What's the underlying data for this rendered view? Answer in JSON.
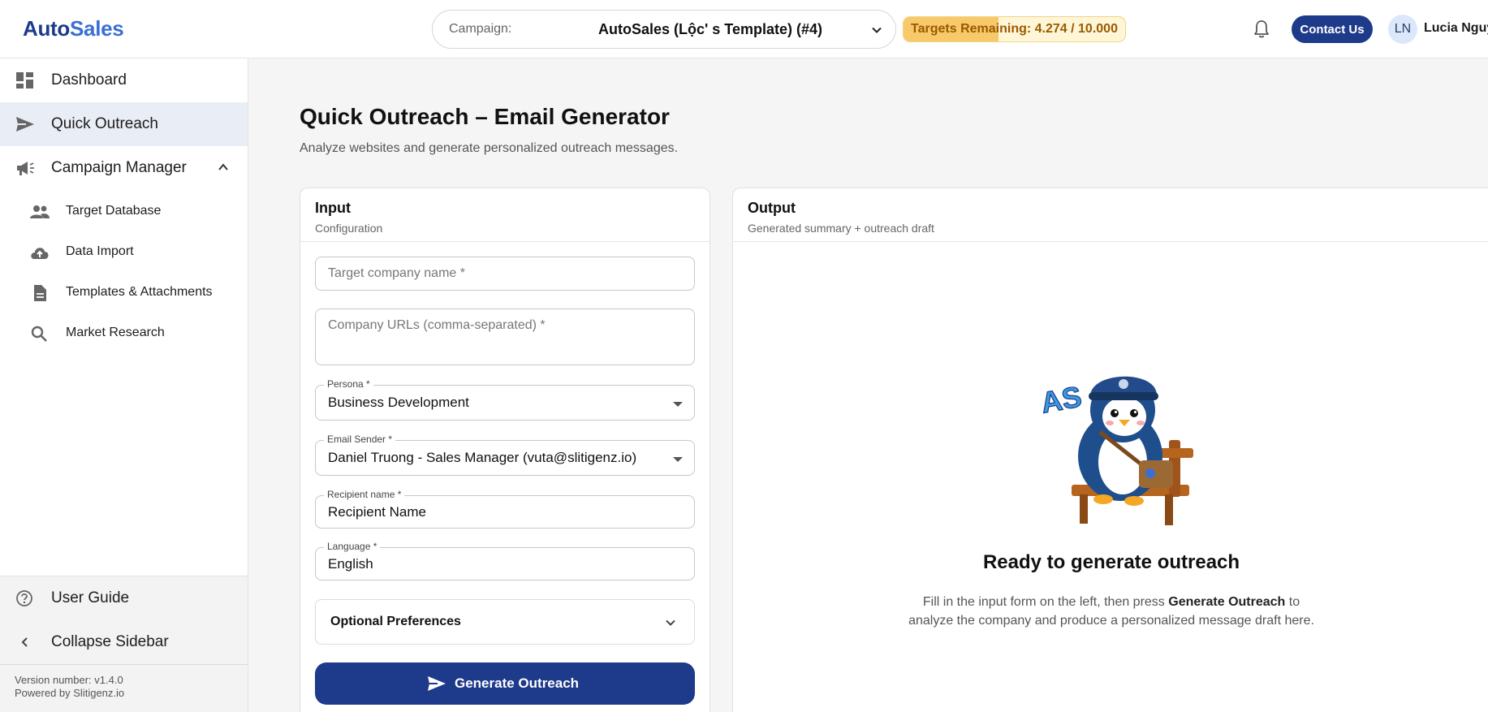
{
  "app": {
    "logo_part1": "Auto",
    "logo_part2": "Sales"
  },
  "header": {
    "campaign_label": "Campaign:",
    "campaign_value": "AutoSales (Lộc' s Template) (#4)",
    "targets_label": "Targets Remaining: 4.274 / 10.000",
    "targets_fraction": 0.4274,
    "contact_label": "Contact Us",
    "avatar_initials": "LN",
    "user_name": "Lucia Nguy"
  },
  "sidebar": {
    "items": [
      {
        "label": "Dashboard",
        "icon": "dashboard-icon"
      },
      {
        "label": "Quick Outreach",
        "icon": "send-icon",
        "active": true
      },
      {
        "label": "Campaign Manager",
        "icon": "megaphone-icon",
        "expanded": true
      }
    ],
    "sub_items": [
      {
        "label": "Target Database",
        "icon": "people-icon"
      },
      {
        "label": "Data Import",
        "icon": "cloud-upload-icon"
      },
      {
        "label": "Templates & Attachments",
        "icon": "document-icon"
      },
      {
        "label": "Market Research",
        "icon": "search-icon"
      }
    ],
    "user_guide": "User Guide",
    "collapse": "Collapse Sidebar",
    "version": "Version number: v1.4.0",
    "powered_by": "Powered by Slitigenz.io"
  },
  "page": {
    "title": "Quick Outreach – Email Generator",
    "subtitle": "Analyze websites and generate personalized outreach messages."
  },
  "input_card": {
    "title": "Input",
    "subtitle": "Configuration",
    "company_placeholder": "Target company name *",
    "urls_placeholder": "Company URLs (comma-separated) *",
    "persona_label": "Persona *",
    "persona_value": "Business Development",
    "sender_label": "Email Sender *",
    "sender_value": "Daniel Truong - Sales Manager (vuta@slitigenz.io)",
    "recipient_label": "Recipient name *",
    "recipient_value": "Recipient Name",
    "language_label": "Language *",
    "language_value": "English",
    "optional_label": "Optional Preferences",
    "generate_label": "Generate Outreach"
  },
  "output_card": {
    "title": "Output",
    "subtitle": "Generated summary + outreach draft",
    "ready_title": "Ready to generate outreach",
    "ready_text_1": "Fill in the input form on the left, then press ",
    "ready_text_bold": "Generate Outreach",
    "ready_text_2": " to analyze the company and produce a personalized message draft here.",
    "mascot_text": "AS"
  },
  "colors": {
    "brand": "#1e3a8a",
    "accent": "#3b6fd4",
    "targets_bg": "#f7c96a"
  }
}
